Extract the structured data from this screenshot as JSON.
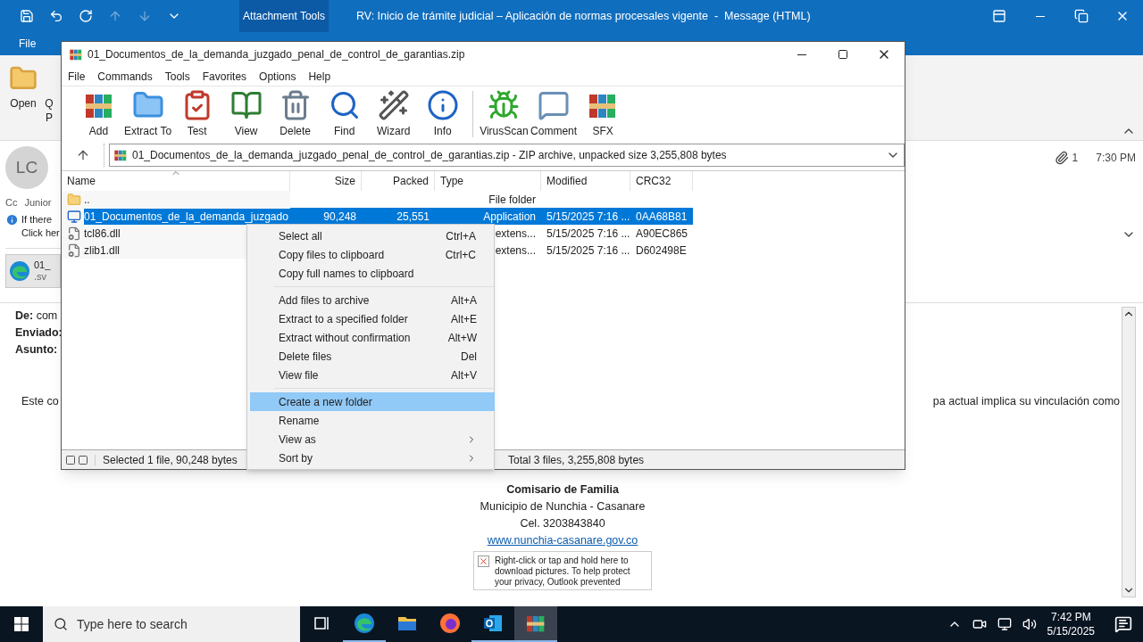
{
  "outlook": {
    "quick_access": [
      {
        "disabled": false
      },
      {
        "disabled": false
      },
      {
        "disabled": false
      },
      {
        "disabled": true
      },
      {
        "disabled": true
      },
      {
        "disabled": false
      }
    ],
    "context_tab": "Attachment Tools",
    "title": "RV: Inicio de trámite judicial – Aplicación de normas procesales vigente  -  Message (HTML)",
    "ribbon_tab": "File",
    "ribbon": [
      {
        "label": "Open"
      },
      {
        "label": "Q",
        "label_2": "P"
      }
    ],
    "sender_initials": "LC",
    "cc_label": "Cc",
    "cc_value": "Junior",
    "info_lines": [
      "If there",
      "Click her"
    ],
    "attachment": {
      "name": "01_",
      "ext": ".sv"
    },
    "attachment_count": "1",
    "time": "7:30 PM",
    "fields": [
      {
        "label": "De:",
        "value": "com"
      },
      {
        "label": "Enviado:"
      },
      {
        "label": "Asunto:"
      }
    ],
    "body_left": "Este co",
    "body_right": "pa actual implica su vinculación como",
    "signature": [
      {
        "text": "Comisario de Familia",
        "kind": "bold"
      },
      {
        "text": "Municipio de Nunchia - Casanare",
        "kind": "plain"
      },
      {
        "text": "Cel. 3203843840",
        "kind": "plain"
      },
      {
        "text": "www.nunchia-casanare.gov.co",
        "kind": "link"
      }
    ],
    "blocked_image_text": "Right-click or tap and hold here to download pictures. To help protect your privacy, Outlook prevented"
  },
  "winrar": {
    "title": "01_Documentos_de_la_demanda_juzgado_penal_de_control_de_garantias.zip",
    "menu": [
      "File",
      "Commands",
      "Tools",
      "Favorites",
      "Options",
      "Help"
    ],
    "toolbar_groups": [
      {
        "buttons": [
          "Add",
          "Extract To",
          "Test",
          "View",
          "Delete",
          "Find",
          "Wizard",
          "Info"
        ]
      },
      {
        "buttons": [
          "VirusScan",
          "Comment",
          "SFX"
        ]
      }
    ],
    "address": "01_Documentos_de_la_demanda_juzgado_penal_de_control_de_garantias.zip - ZIP archive, unpacked size 3,255,808 bytes",
    "columns": [
      "Name",
      "Size",
      "Packed",
      "Type",
      "Modified",
      "CRC32"
    ],
    "rows": [
      {
        "kind": "folder",
        "name": "..",
        "type": "File folder",
        "selected": false
      },
      {
        "kind": "app",
        "name": "01_Documentos_de_la_demanda_juzgado",
        "size": "90,248",
        "packed": "25,551",
        "type": "Application",
        "modified": "5/15/2025 7:16 ...",
        "crc": "0AA68B81",
        "selected": true
      },
      {
        "kind": "dll",
        "name": "tcl86.dll",
        "type": "extens...",
        "modified": "5/15/2025 7:16 ...",
        "crc": "A90EC865",
        "selected": false
      },
      {
        "kind": "dll",
        "name": "zlib1.dll",
        "type": "extens...",
        "modified": "5/15/2025 7:16 ...",
        "crc": "D602498E",
        "selected": false
      }
    ],
    "status_left": "Selected 1 file, 90,248 bytes",
    "status_right": "Total 3 files, 3,255,808 bytes"
  },
  "context_menu": {
    "groups": [
      {
        "items": [
          {
            "label": "Select all",
            "shortcut": "Ctrl+A",
            "submenu": false,
            "selected": false
          },
          {
            "label": "Copy files to clipboard",
            "shortcut": "Ctrl+C",
            "submenu": false,
            "selected": false
          },
          {
            "label": "Copy full names to clipboard",
            "submenu": false,
            "selected": false
          }
        ]
      },
      {
        "items": [
          {
            "label": "Add files to archive",
            "shortcut": "Alt+A",
            "submenu": false,
            "selected": false
          },
          {
            "label": "Extract to a specified folder",
            "shortcut": "Alt+E",
            "submenu": false,
            "selected": false
          },
          {
            "label": "Extract without confirmation",
            "shortcut": "Alt+W",
            "submenu": false,
            "selected": false
          },
          {
            "label": "Delete files",
            "shortcut": "Del",
            "submenu": false,
            "selected": false
          },
          {
            "label": "View file",
            "shortcut": "Alt+V",
            "submenu": false,
            "selected": false
          }
        ]
      },
      {
        "items": [
          {
            "label": "Create a new folder",
            "submenu": false,
            "selected": true
          },
          {
            "label": "Rename",
            "submenu": false,
            "selected": false
          },
          {
            "label": "View as",
            "submenu": true,
            "selected": false
          },
          {
            "label": "Sort by",
            "submenu": true,
            "selected": false
          }
        ]
      }
    ]
  },
  "taskbar": {
    "search_placeholder": "Type here to search",
    "apps": [
      {
        "running": false,
        "selected": false
      },
      {
        "running": true,
        "selected": false
      },
      {
        "running": false,
        "selected": false
      },
      {
        "running": false,
        "selected": false
      },
      {
        "running": true,
        "selected": false
      },
      {
        "running": true,
        "selected": true
      }
    ],
    "time": "7:42 PM",
    "date": "5/15/2025"
  }
}
